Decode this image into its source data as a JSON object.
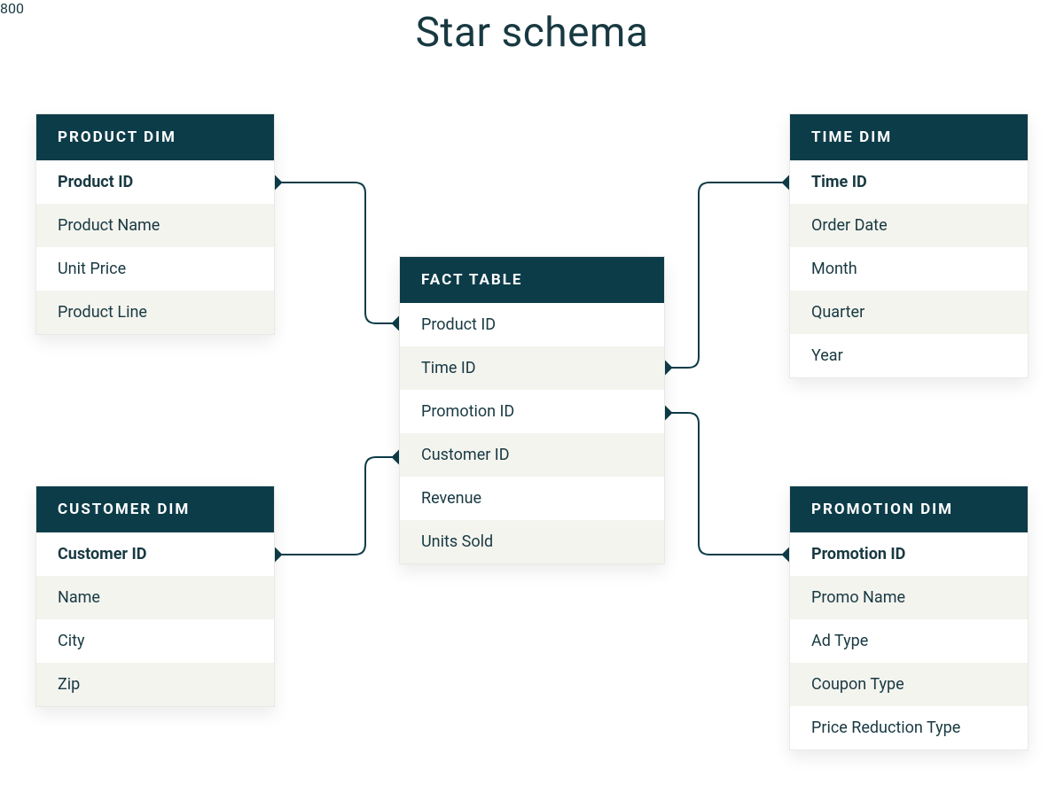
{
  "title": "Star schema",
  "tables": {
    "product_dim": {
      "header": "PRODUCT DIM",
      "rows": [
        "Product ID",
        "Product Name",
        "Unit Price",
        "Product Line"
      ]
    },
    "time_dim": {
      "header": "TIME DIM",
      "rows": [
        "Time ID",
        "Order Date",
        "Month",
        "Quarter",
        "Year"
      ]
    },
    "fact": {
      "header": "FACT TABLE",
      "rows": [
        "Product ID",
        "Time ID",
        "Promotion ID",
        "Customer ID",
        "Revenue",
        "Units Sold"
      ]
    },
    "customer_dim": {
      "header": "CUSTOMER DIM",
      "rows": [
        "Customer ID",
        "Name",
        "City",
        "Zip"
      ]
    },
    "promotion_dim": {
      "header": "PROMOTION DIM",
      "rows": [
        "Promotion ID",
        "Promo Name",
        "Ad Type",
        "Coupon Type",
        "Price Reduction Type"
      ]
    }
  }
}
